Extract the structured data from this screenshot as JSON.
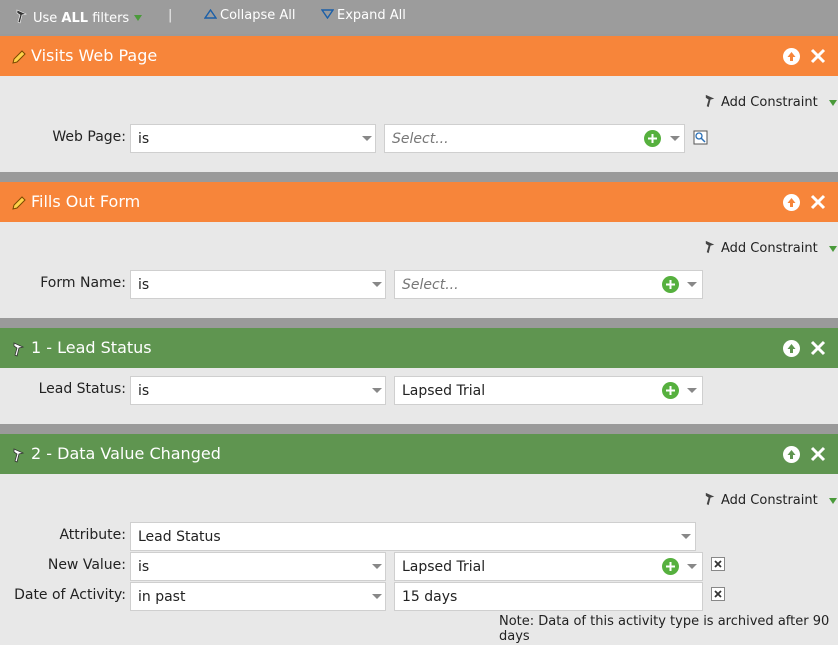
{
  "toolbar": {
    "use_prefix": "Use ",
    "use_bold": "ALL",
    "use_suffix": " filters",
    "separator": "|",
    "collapse_all": "Collapse All",
    "expand_all": "Expand All"
  },
  "filters": [
    {
      "title": "Visits Web Page",
      "color": "#f7853a",
      "add_constraint": "Add Constraint",
      "rows": [
        {
          "label": "Web Page:",
          "operator": "is",
          "value_placeholder": "Select..."
        }
      ]
    },
    {
      "title": "Fills Out Form",
      "color": "#f7853a",
      "add_constraint": "Add Constraint",
      "rows": [
        {
          "label": "Form Name:",
          "operator": "is",
          "value_placeholder": "Select..."
        }
      ]
    },
    {
      "title": "1 - Lead Status",
      "color": "#5f9550",
      "rows": [
        {
          "label": "Lead Status:",
          "operator": "is",
          "value": "Lapsed Trial"
        }
      ]
    },
    {
      "title": "2 - Data Value Changed",
      "color": "#5f9550",
      "add_constraint": "Add Constraint",
      "rows": [
        {
          "label": "Attribute:",
          "value": "Lead Status"
        },
        {
          "label": "New Value:",
          "operator": "is",
          "value": "Lapsed Trial"
        },
        {
          "label": "Date of Activity:",
          "operator": "in past",
          "value": "15 days"
        }
      ],
      "note": "Note: Data of this activity type is archived after 90 days"
    }
  ]
}
